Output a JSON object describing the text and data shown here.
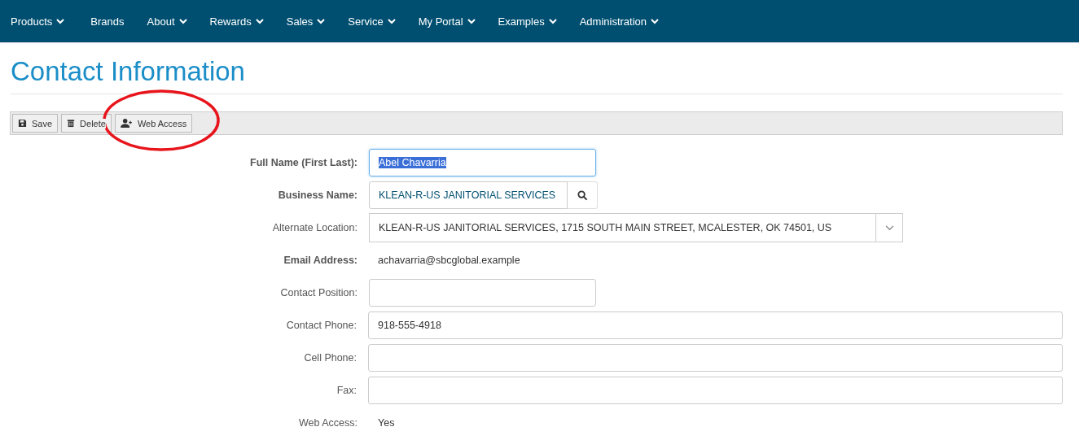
{
  "nav": [
    {
      "label": "Products",
      "dropdown": true
    },
    {
      "label": "Brands",
      "dropdown": false
    },
    {
      "label": "About",
      "dropdown": true
    },
    {
      "label": "Rewards",
      "dropdown": true
    },
    {
      "label": "Sales",
      "dropdown": true
    },
    {
      "label": "Service",
      "dropdown": true
    },
    {
      "label": "My Portal",
      "dropdown": true
    },
    {
      "label": "Examples",
      "dropdown": true
    },
    {
      "label": "Administration",
      "dropdown": true
    }
  ],
  "title": "Contact Information",
  "toolbar": [
    {
      "label": "Save",
      "circled": false
    },
    {
      "label": "Delete",
      "circled": false
    },
    {
      "label": "Web Access",
      "circled": true
    }
  ],
  "fields": [
    {
      "label": "Full Name (First Last):",
      "bold": true,
      "kind": "input",
      "value": "Abel Chavarria",
      "focused": true
    },
    {
      "label": "Business Name:",
      "bold": true,
      "kind": "search",
      "value": "KLEAN-R-US JANITORIAL SERVICES",
      "focused": false
    },
    {
      "label": "Alternate Location:",
      "bold": false,
      "kind": "select",
      "value": "KLEAN-R-US JANITORIAL SERVICES, 1715 SOUTH MAIN STREET, MCALESTER, OK  74501, US",
      "focused": false
    },
    {
      "label": "Email Address:",
      "bold": true,
      "kind": "static",
      "value": "achavarria@sbcglobal.example"
    },
    {
      "label": "Contact Position:",
      "bold": false,
      "kind": "input",
      "focused": false
    },
    {
      "label": "Contact Phone:",
      "bold": false,
      "kind": "wide_input",
      "value": "918-555-4918",
      "focused": false
    },
    {
      "label": "Cell Phone:",
      "bold": false,
      "kind": "wide_input",
      "focused": false
    },
    {
      "label": "Fax:",
      "bold": false,
      "kind": "wide_input",
      "focused": false
    },
    {
      "label": "Web Access:",
      "bold": false,
      "kind": "static",
      "value": "Yes"
    }
  ]
}
